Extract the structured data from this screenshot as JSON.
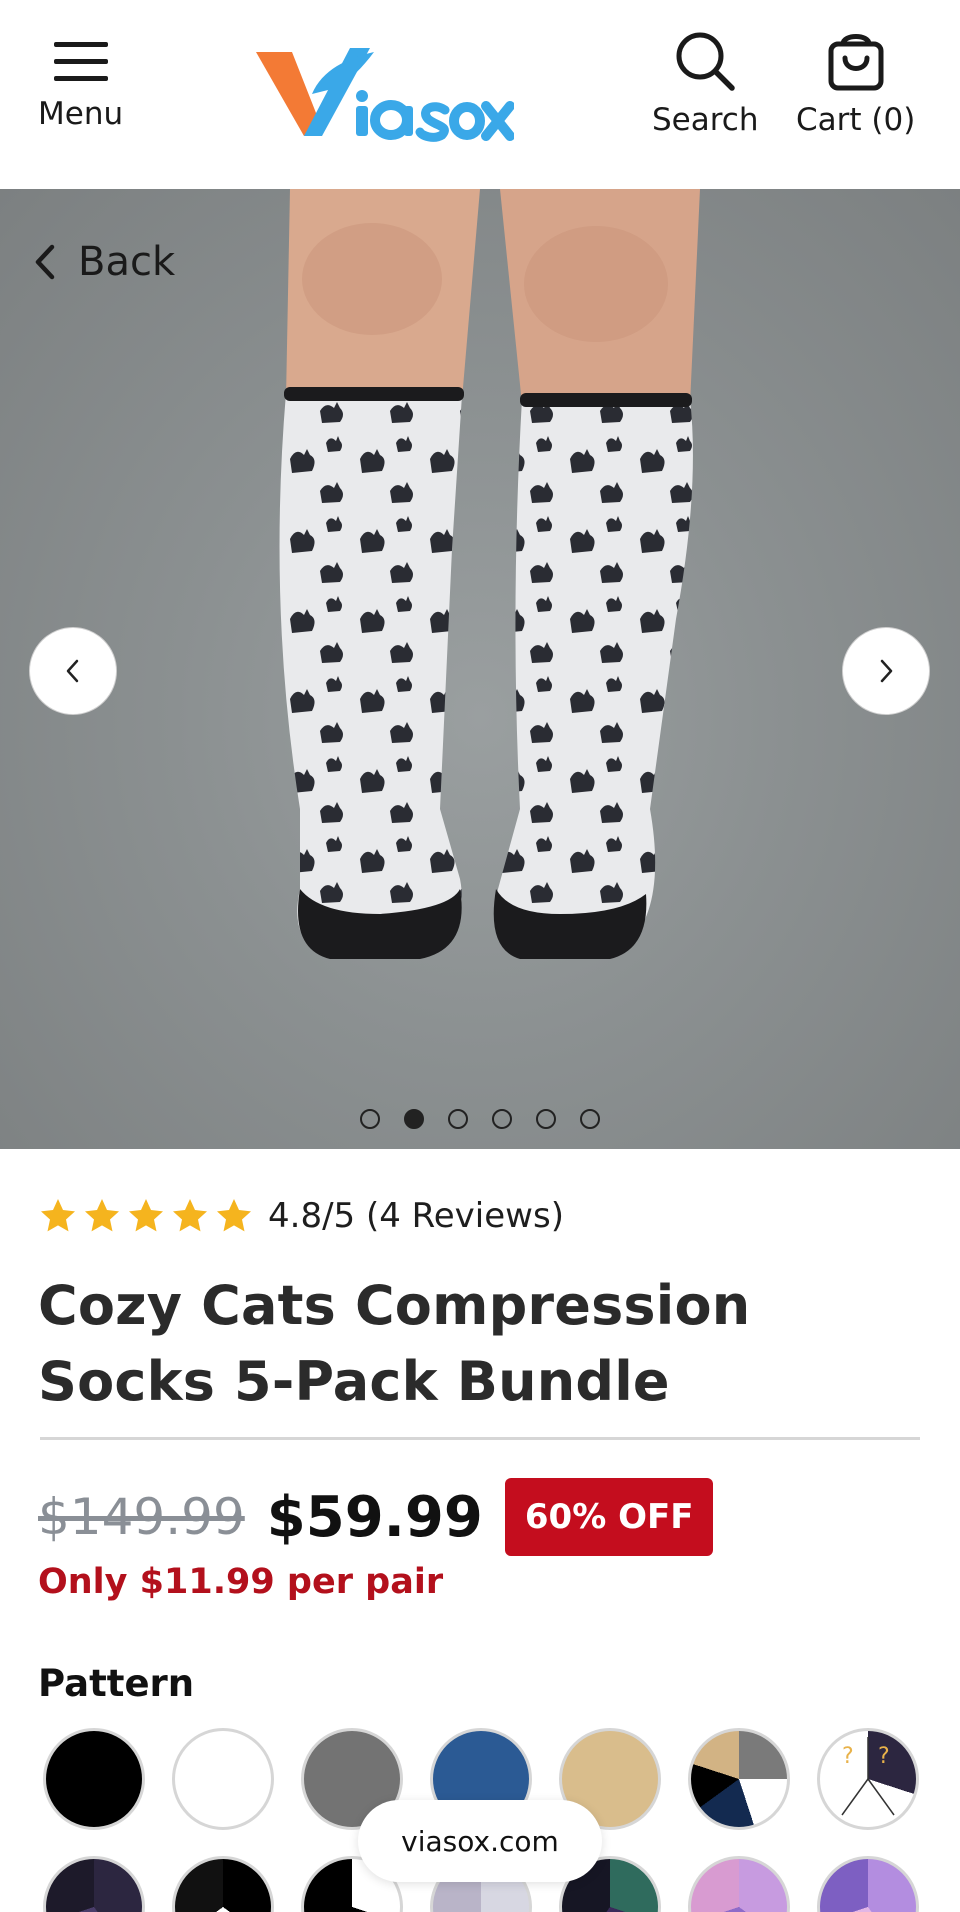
{
  "header": {
    "menu_label": "Menu",
    "search_label": "Search",
    "cart_label": "Cart (0)",
    "logo_text": "Viasox",
    "brand_colors": {
      "orange": "#f37a35",
      "blue": "#3aa8e8"
    }
  },
  "hero": {
    "back_label": "Back",
    "image_alt_icon": "product-photo",
    "slide_count": 6,
    "active_slide": 2
  },
  "product": {
    "rating_text": "4.8/5 (4 Reviews)",
    "stars": 5,
    "title": "Cozy Cats Compression Socks 5-Pack Bundle",
    "old_price": "$149.99",
    "price": "$59.99",
    "discount": "60% OFF",
    "per_pair": "Only $11.99 per pair",
    "pattern_label": "Pattern"
  },
  "colors": {
    "accent_red": "#c40d1e",
    "per_pair_red": "#b3101c",
    "star": "#f5b41e"
  },
  "browser": {
    "url": "viasox.com"
  }
}
